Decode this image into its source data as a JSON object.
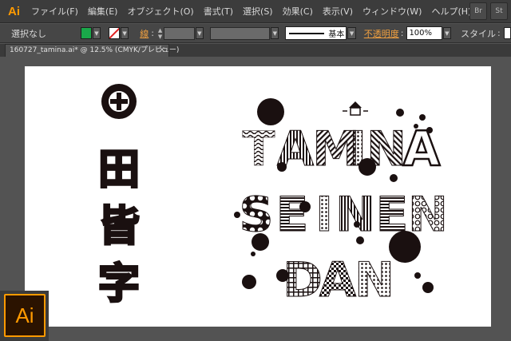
{
  "app": {
    "logo": "Ai",
    "accent": "#ff9a00"
  },
  "menu": {
    "items": [
      "ファイル(F)",
      "編集(E)",
      "オブジェクト(O)",
      "書式(T)",
      "選択(S)",
      "効果(C)",
      "表示(V)",
      "ウィンドウ(W)",
      "ヘルプ(H)"
    ],
    "right_buttons": [
      "Br",
      "St"
    ]
  },
  "control": {
    "selection_status": "選択なし",
    "fill_color": "#1aa84a",
    "stroke_label": "線",
    "profile_label": "基本",
    "opacity_label": "不透明度",
    "opacity_value": "100%",
    "style_label": "スタイル"
  },
  "tabs": [
    {
      "label": "160727_tamina.ai* @ 12.5% (CMYK/プレビュー)",
      "close": "×"
    }
  ],
  "artwork": {
    "vertical_title": [
      "田",
      "皆",
      "字"
    ],
    "lines": [
      {
        "text": "TAMINA",
        "letters": [
          "T",
          "A",
          "M",
          "I",
          "N",
          "A"
        ]
      },
      {
        "text": "SEINEN",
        "letters": [
          "S",
          "E",
          "I",
          "N",
          "E",
          "N"
        ]
      },
      {
        "text": "DAN",
        "letters": [
          "D",
          "A",
          "N"
        ]
      }
    ]
  },
  "badge": {
    "label": "Ai"
  }
}
